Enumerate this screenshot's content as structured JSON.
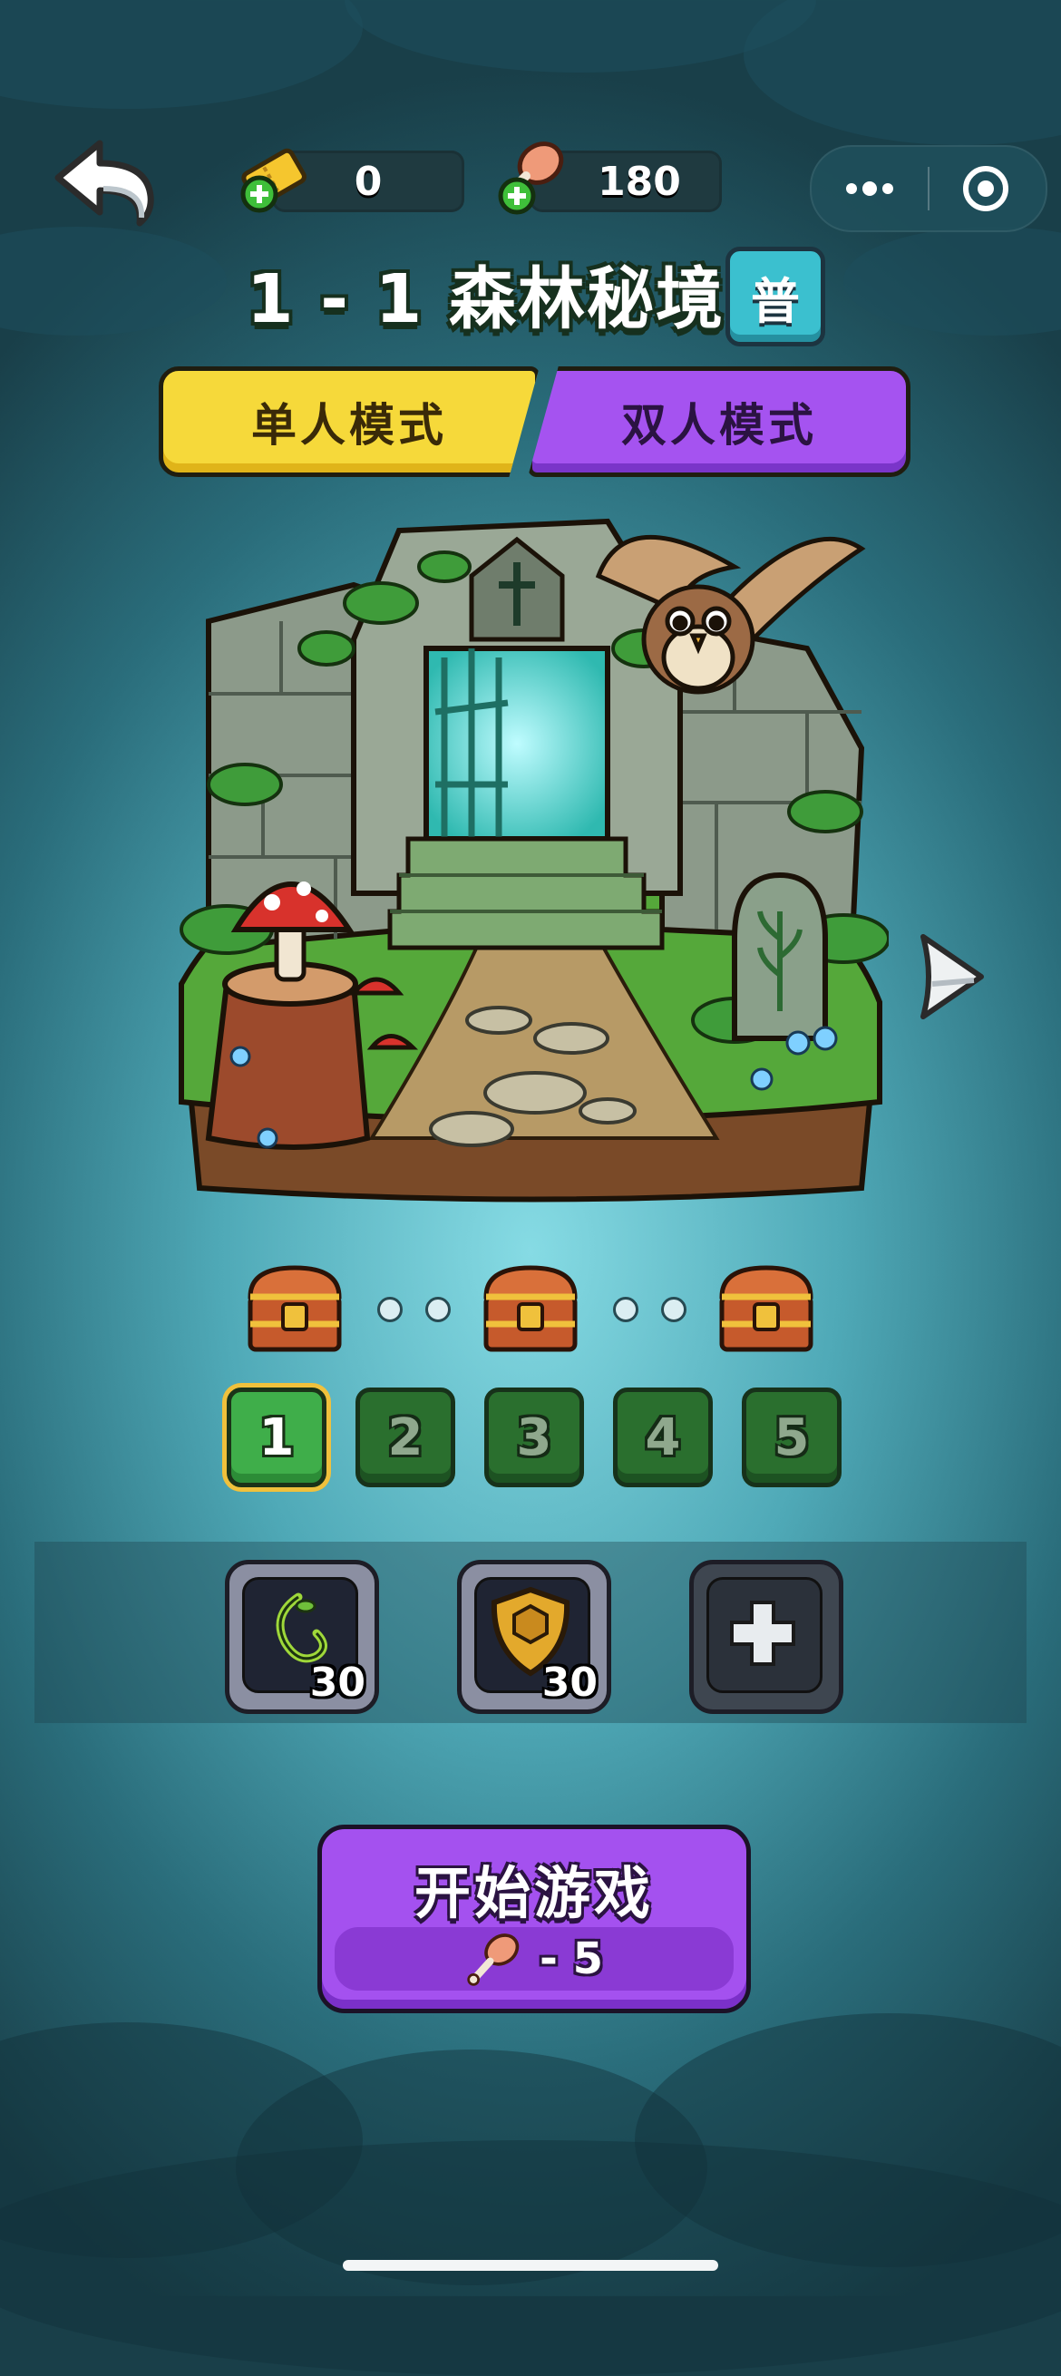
{
  "colors": {
    "accent_yellow": "#f6d93a",
    "accent_purple": "#a553f0",
    "level_active": "#3fae4a",
    "background": "#4fa9b7"
  },
  "header": {
    "back_icon": "back-arrow-icon",
    "tickets": {
      "icon": "ticket-plus-icon",
      "value": "0"
    },
    "food": {
      "icon": "drumstick-plus-icon",
      "value": "180"
    },
    "capsule": {
      "more_icon": "more-dots-icon",
      "target_icon": "target-icon"
    }
  },
  "level": {
    "title": "1 - 1 森林秘境",
    "difficulty": "普"
  },
  "modes": [
    {
      "label": "单人模式",
      "selected": true
    },
    {
      "label": "双人模式",
      "selected": false
    }
  ],
  "scene": {
    "image": "forest-ruins-illustration",
    "next_icon": "next-arrow-icon"
  },
  "rewards": {
    "chest_icon": "treasure-chest-icon",
    "chests": 3
  },
  "stages": [
    {
      "label": "1",
      "active": true
    },
    {
      "label": "2",
      "active": false
    },
    {
      "label": "3",
      "active": false
    },
    {
      "label": "4",
      "active": false
    },
    {
      "label": "5",
      "active": false
    }
  ],
  "items": [
    {
      "icon": "vine-icon",
      "count": "30"
    },
    {
      "icon": "shield-icon",
      "count": "30"
    },
    {
      "icon": "plus-icon",
      "count": ""
    }
  ],
  "start": {
    "label": "开始游戏",
    "cost_icon": "drumstick-icon",
    "cost": "- 5"
  }
}
